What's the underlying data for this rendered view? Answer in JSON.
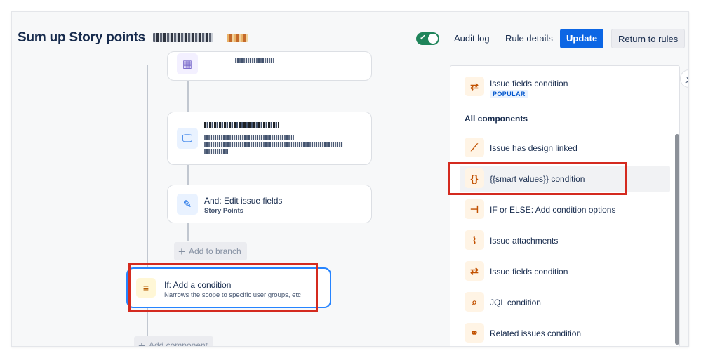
{
  "header": {
    "title": "Sum up Story points",
    "toggle_on": true,
    "audit_log": "Audit log",
    "rule_details": "Rule details",
    "update": "Update",
    "return_to_rules": "Return to rules"
  },
  "canvas": {
    "edit_card": {
      "title": "And: Edit issue fields",
      "subtitle": "Story Points"
    },
    "add_to_branch": "Add to branch",
    "if_card": {
      "title": "If: Add a condition",
      "subtitle": "Narrows the scope to specific user groups, etc"
    },
    "add_component": "Add component"
  },
  "panel": {
    "popular_item": {
      "label": "Issue fields condition",
      "badge": "POPULAR",
      "icon": "shuffle-icon"
    },
    "section_title": "All components",
    "items": [
      {
        "label": "Issue has design linked",
        "icon": "design-link-icon"
      },
      {
        "label": "{{smart values}} condition",
        "icon": "braces-icon"
      },
      {
        "label": "IF or ELSE: Add condition options",
        "icon": "branch-icon"
      },
      {
        "label": "Issue attachments",
        "icon": "paperclip-icon"
      },
      {
        "label": "Issue fields condition",
        "icon": "shuffle-icon"
      },
      {
        "label": "JQL condition",
        "icon": "search-icon"
      },
      {
        "label": "Related issues condition",
        "icon": "link-icon"
      }
    ]
  },
  "colors": {
    "accent": "#0c66e4",
    "toggle": "#1f845a",
    "highlight": "#d42a1f",
    "icon_orange": "#c25100"
  }
}
